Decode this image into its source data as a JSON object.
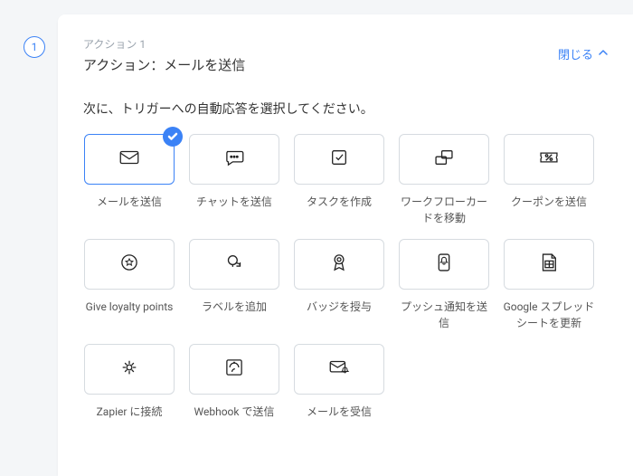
{
  "step": {
    "number": "1"
  },
  "header": {
    "eyebrow": "アクション 1",
    "title": "アクション：メールを送信",
    "close_label": "閉じる"
  },
  "prompt": "次に、トリガーへの自動応答を選択してください。",
  "actions": [
    {
      "label": "メールを送信",
      "icon": "envelope-icon",
      "selected": true
    },
    {
      "label": "チャットを送信",
      "icon": "chat-icon",
      "selected": false
    },
    {
      "label": "タスクを作成",
      "icon": "task-icon",
      "selected": false
    },
    {
      "label": "ワークフローカードを移動",
      "icon": "workflow-card-icon",
      "selected": false
    },
    {
      "label": "クーポンを送信",
      "icon": "coupon-icon",
      "selected": false
    },
    {
      "label": "Give loyalty points",
      "icon": "loyalty-points-icon",
      "selected": false
    },
    {
      "label": "ラベルを追加",
      "icon": "label-icon",
      "selected": false
    },
    {
      "label": "バッジを授与",
      "icon": "badge-icon",
      "selected": false
    },
    {
      "label": "プッシュ通知を送信",
      "icon": "push-notification-icon",
      "selected": false
    },
    {
      "label": "Google スプレッドシートを更新",
      "icon": "spreadsheet-icon",
      "selected": false
    },
    {
      "label": "Zapier に接続",
      "icon": "zapier-icon",
      "selected": false
    },
    {
      "label": "Webhook で送信",
      "icon": "webhook-icon",
      "selected": false
    },
    {
      "label": "メールを受信",
      "icon": "receive-mail-icon",
      "selected": false
    }
  ]
}
